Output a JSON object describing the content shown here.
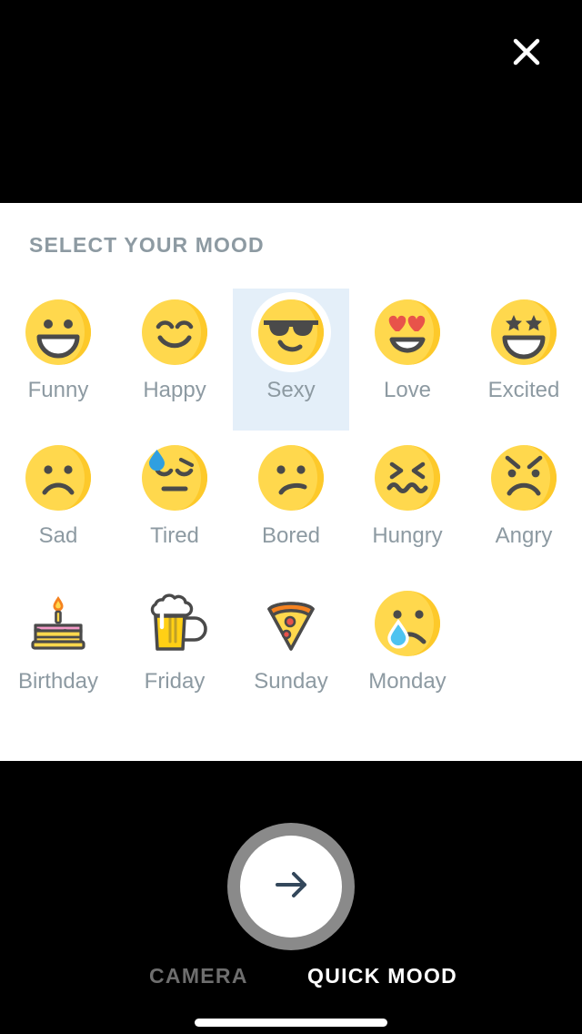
{
  "header": {
    "close_icon": "close-icon"
  },
  "panel": {
    "title": "SELECT YOUR MOOD"
  },
  "moods": [
    [
      {
        "id": "funny",
        "label": "Funny",
        "art": "smile-open-eyes-dots",
        "selected": false
      },
      {
        "id": "happy",
        "label": "Happy",
        "art": "smile-closed-eyes",
        "selected": false
      },
      {
        "id": "sexy",
        "label": "Sexy",
        "art": "sunglasses-smirk",
        "selected": true
      },
      {
        "id": "love",
        "label": "Love",
        "art": "heart-eyes-open-smile",
        "selected": false
      },
      {
        "id": "excited",
        "label": "Excited",
        "art": "star-eyes-open-smile",
        "selected": false
      }
    ],
    [
      {
        "id": "sad",
        "label": "Sad",
        "art": "frown-dot-eyes",
        "selected": false
      },
      {
        "id": "tired",
        "label": "Tired",
        "art": "sleepy-sweat-flat",
        "selected": false
      },
      {
        "id": "bored",
        "label": "Bored",
        "art": "bored-slight-frown",
        "selected": false
      },
      {
        "id": "hungry",
        "label": "Hungry",
        "art": "x-eyes-wavy-mouth",
        "selected": false
      },
      {
        "id": "angry",
        "label": "Angry",
        "art": "angry-brows-frown",
        "selected": false
      }
    ],
    [
      {
        "id": "birthday",
        "label": "Birthday",
        "art": "birthday-cake",
        "selected": false
      },
      {
        "id": "friday",
        "label": "Friday",
        "art": "beer-mug",
        "selected": false
      },
      {
        "id": "sunday",
        "label": "Sunday",
        "art": "pizza-slice",
        "selected": false
      },
      {
        "id": "monday",
        "label": "Monday",
        "art": "crying-tear",
        "selected": false
      }
    ]
  ],
  "bottom": {
    "shutter_icon": "arrow-right-icon",
    "tabs": [
      {
        "id": "camera",
        "label": "CAMERA",
        "active": false
      },
      {
        "id": "quick-mood",
        "label": "QUICK MOOD",
        "active": true
      }
    ]
  },
  "colors": {
    "emoji_yellow": "#FDC92A",
    "emoji_yellow_light": "#FFD84D",
    "emoji_stroke": "#4a4a4a",
    "selected_bg": "#E4EFF9",
    "label_gray": "#8D9AA2",
    "tab_inactive": "#6E6E6E",
    "tab_active": "#FFFFFF",
    "arrow_navy": "#33475B",
    "heart_red": "#E8534A",
    "tear_blue": "#4EC3F0",
    "cake_pink": "#F49AC8"
  }
}
